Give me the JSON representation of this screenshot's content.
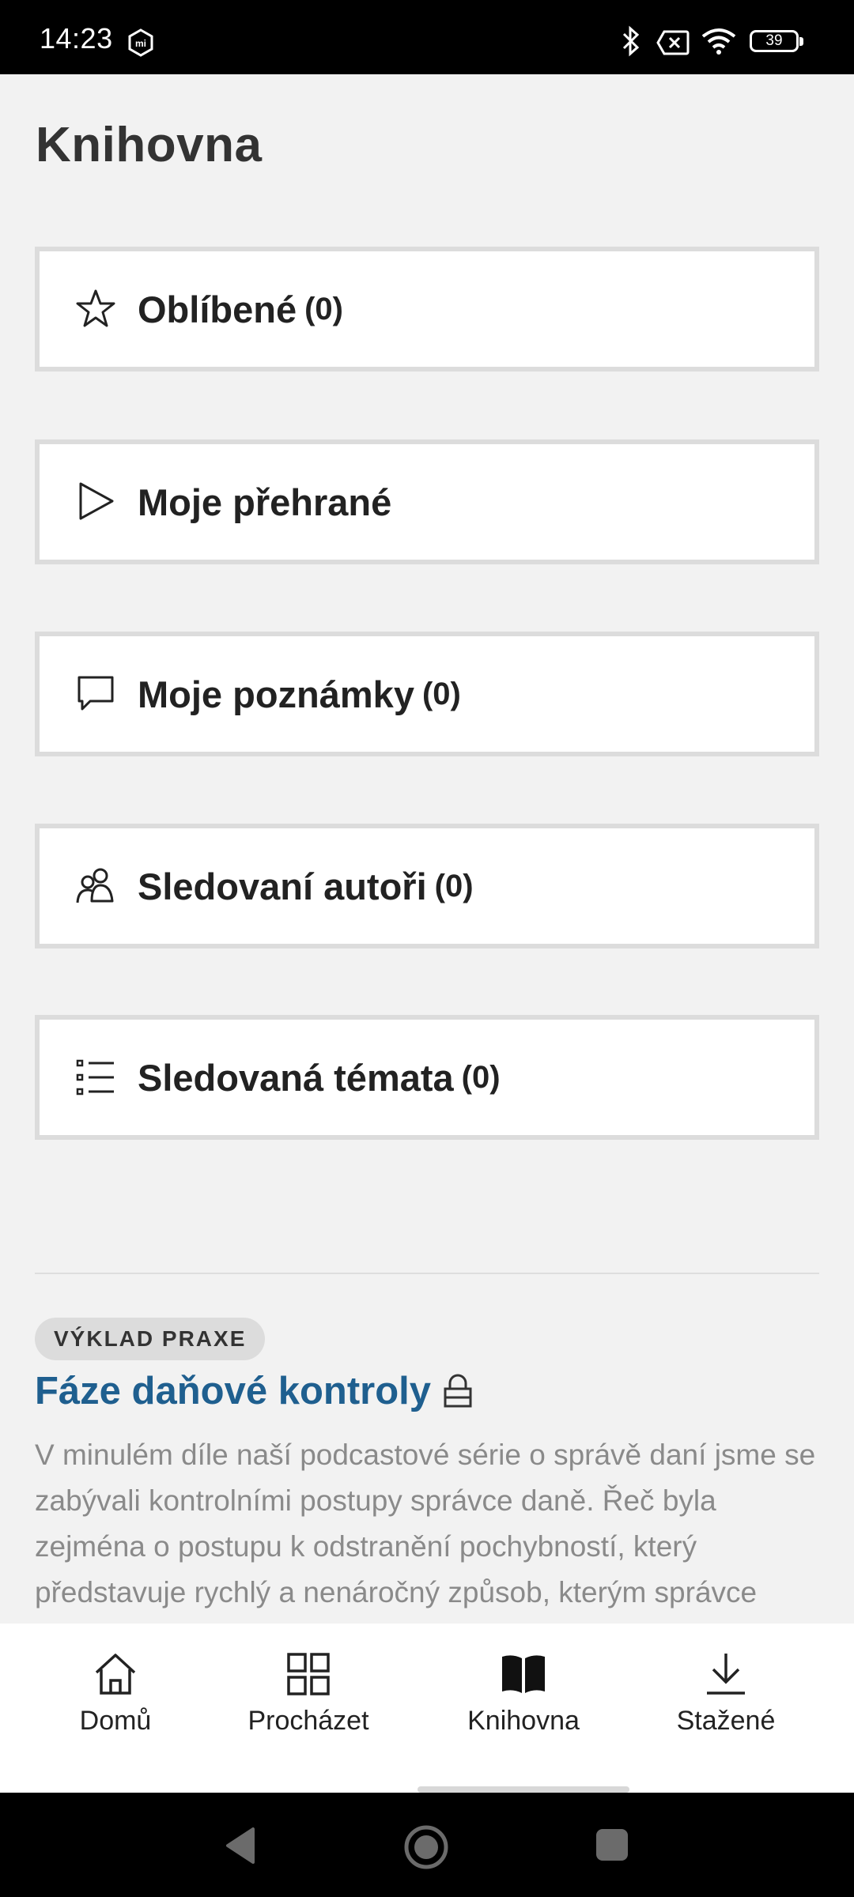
{
  "status_bar": {
    "time": "14:23",
    "battery": "39",
    "icons": [
      "mi-icon",
      "bluetooth-icon",
      "no-sim-icon",
      "wifi-icon",
      "battery-icon"
    ]
  },
  "page": {
    "title": "Knihovna"
  },
  "library_items": [
    {
      "label": "Oblíbené",
      "count": "(0)",
      "icon": "star-icon"
    },
    {
      "label": "Moje přehrané",
      "count": "",
      "icon": "play-icon"
    },
    {
      "label": "Moje poznámky",
      "count": "(0)",
      "icon": "comment-icon"
    },
    {
      "label": "Sledovaní autoři",
      "count": "(0)",
      "icon": "users-icon"
    },
    {
      "label": "Sledovaná témata",
      "count": "(0)",
      "icon": "list-icon"
    }
  ],
  "article": {
    "badge": "VÝKLAD PRAXE",
    "title": "Fáze daňové kontroly",
    "text": "V minulém díle naší podcastové série o správě daní jsme se zabývali kontrolními postupy správce daně. Řeč byla zejména o postupu k odstranění pochybností, který představuje rychlý a nenáročný způsob, kterým správce",
    "title_color": "#1f5f8f",
    "icon": "lock-icon"
  },
  "bottom_nav": [
    {
      "label": "Domů",
      "icon": "home-icon",
      "active": false
    },
    {
      "label": "Procházet",
      "icon": "grid-icon",
      "active": false
    },
    {
      "label": "Knihovna",
      "icon": "book-icon",
      "active": true
    },
    {
      "label": "Stažené",
      "icon": "download-icon",
      "active": false
    }
  ],
  "system_nav": [
    "back-icon",
    "home-circle-icon",
    "recents-icon"
  ]
}
